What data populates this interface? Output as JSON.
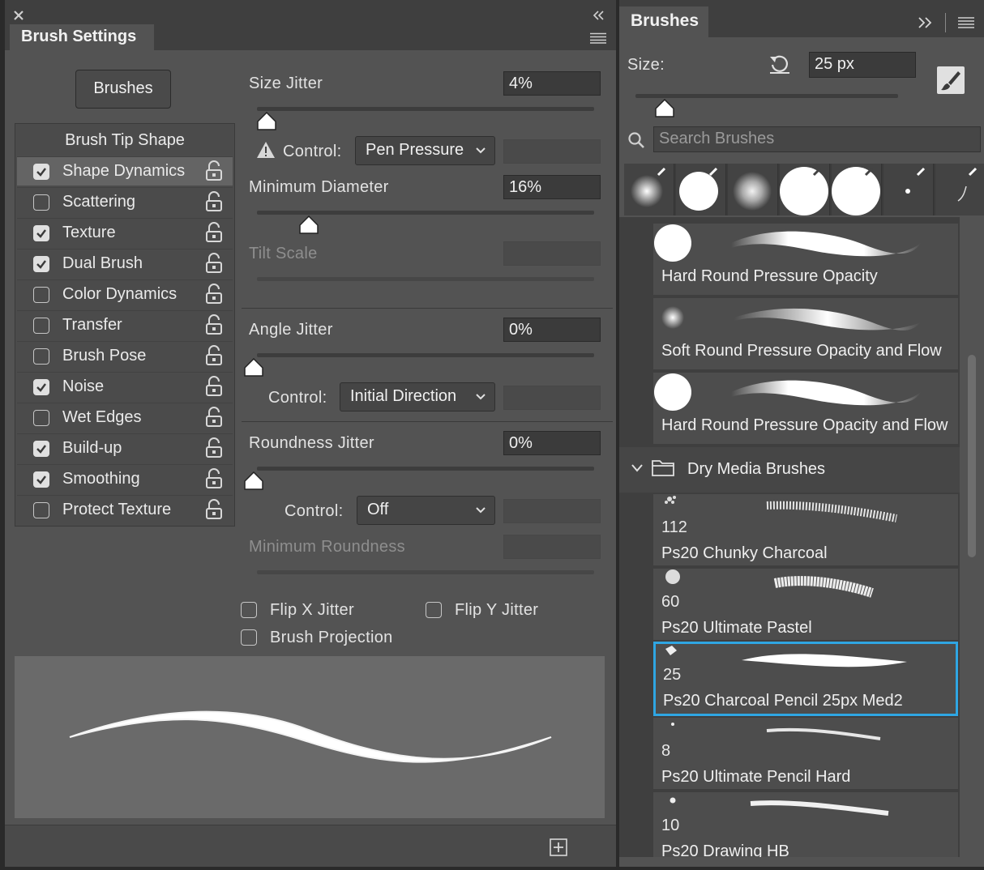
{
  "left_panel": {
    "title": "Brush Settings",
    "brushes_button": "Brushes",
    "list_header": "Brush Tip Shape",
    "options": [
      {
        "label": "Shape Dynamics",
        "checked": true,
        "selected": true
      },
      {
        "label": "Scattering",
        "checked": false
      },
      {
        "label": "Texture",
        "checked": true
      },
      {
        "label": "Dual Brush",
        "checked": true
      },
      {
        "label": "Color Dynamics",
        "checked": false
      },
      {
        "label": "Transfer",
        "checked": false
      },
      {
        "label": "Brush Pose",
        "checked": false
      },
      {
        "label": "Noise",
        "checked": true
      },
      {
        "label": "Wet Edges",
        "checked": false
      },
      {
        "label": "Build-up",
        "checked": true
      },
      {
        "label": "Smoothing",
        "checked": true
      },
      {
        "label": "Protect Texture",
        "checked": false
      }
    ],
    "size_jitter": {
      "label": "Size Jitter",
      "value": "4%",
      "slider": 0.04
    },
    "control1": {
      "label": "Control:",
      "value": "Pen Pressure"
    },
    "min_diameter": {
      "label": "Minimum Diameter",
      "value": "16%",
      "slider": 0.16
    },
    "tilt_scale": {
      "label": "Tilt Scale"
    },
    "angle_jitter": {
      "label": "Angle Jitter",
      "value": "0%",
      "slider": 0
    },
    "control2": {
      "label": "Control:",
      "value": "Initial Direction"
    },
    "roundness_jitter": {
      "label": "Roundness Jitter",
      "value": "0%",
      "slider": 0
    },
    "control3": {
      "label": "Control:",
      "value": "Off"
    },
    "min_roundness": {
      "label": "Minimum Roundness"
    },
    "flip_x": {
      "label": "Flip X Jitter",
      "checked": false
    },
    "flip_y": {
      "label": "Flip Y Jitter",
      "checked": false
    },
    "brush_projection": {
      "label": "Brush Projection",
      "checked": false
    }
  },
  "right_panel": {
    "title": "Brushes",
    "size_label": "Size:",
    "size_value": "25 px",
    "size_slider": 0.1,
    "search_placeholder": "Search Brushes",
    "brushes": [
      {
        "name": "Hard Round Pressure Opacity"
      },
      {
        "name": "Soft Round Pressure Opacity and Flow"
      },
      {
        "name": "Hard Round Pressure Opacity and Flow"
      }
    ],
    "folder": "Dry Media Brushes",
    "dry_brushes": [
      {
        "size": "112",
        "name": "Ps20  Chunky Charcoal"
      },
      {
        "size": "60",
        "name": "Ps20 Ultimate Pastel"
      },
      {
        "size": "25",
        "name": "Ps20 Charcoal Pencil 25px Med2",
        "selected": true
      },
      {
        "size": "8",
        "name": "Ps20 Ultimate Pencil Hard"
      },
      {
        "size": "10",
        "name": "Ps20 Drawing HB"
      }
    ]
  },
  "colors": {
    "panel": "#535353",
    "selection": "#2fa6e3"
  }
}
